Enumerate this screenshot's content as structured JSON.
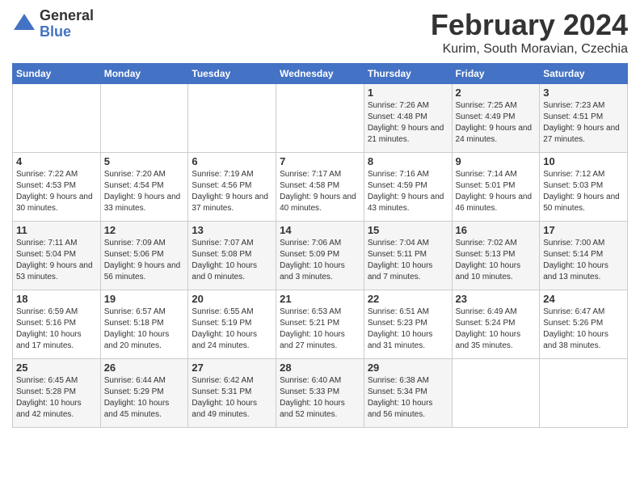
{
  "logo": {
    "general": "General",
    "blue": "Blue"
  },
  "title": {
    "month_year": "February 2024",
    "location": "Kurim, South Moravian, Czechia"
  },
  "days_of_week": [
    "Sunday",
    "Monday",
    "Tuesday",
    "Wednesday",
    "Thursday",
    "Friday",
    "Saturday"
  ],
  "weeks": [
    [
      {
        "day": "",
        "content": ""
      },
      {
        "day": "",
        "content": ""
      },
      {
        "day": "",
        "content": ""
      },
      {
        "day": "",
        "content": ""
      },
      {
        "day": "1",
        "content": "Sunrise: 7:26 AM\nSunset: 4:48 PM\nDaylight: 9 hours\nand 21 minutes."
      },
      {
        "day": "2",
        "content": "Sunrise: 7:25 AM\nSunset: 4:49 PM\nDaylight: 9 hours\nand 24 minutes."
      },
      {
        "day": "3",
        "content": "Sunrise: 7:23 AM\nSunset: 4:51 PM\nDaylight: 9 hours\nand 27 minutes."
      }
    ],
    [
      {
        "day": "4",
        "content": "Sunrise: 7:22 AM\nSunset: 4:53 PM\nDaylight: 9 hours\nand 30 minutes."
      },
      {
        "day": "5",
        "content": "Sunrise: 7:20 AM\nSunset: 4:54 PM\nDaylight: 9 hours\nand 33 minutes."
      },
      {
        "day": "6",
        "content": "Sunrise: 7:19 AM\nSunset: 4:56 PM\nDaylight: 9 hours\nand 37 minutes."
      },
      {
        "day": "7",
        "content": "Sunrise: 7:17 AM\nSunset: 4:58 PM\nDaylight: 9 hours\nand 40 minutes."
      },
      {
        "day": "8",
        "content": "Sunrise: 7:16 AM\nSunset: 4:59 PM\nDaylight: 9 hours\nand 43 minutes."
      },
      {
        "day": "9",
        "content": "Sunrise: 7:14 AM\nSunset: 5:01 PM\nDaylight: 9 hours\nand 46 minutes."
      },
      {
        "day": "10",
        "content": "Sunrise: 7:12 AM\nSunset: 5:03 PM\nDaylight: 9 hours\nand 50 minutes."
      }
    ],
    [
      {
        "day": "11",
        "content": "Sunrise: 7:11 AM\nSunset: 5:04 PM\nDaylight: 9 hours\nand 53 minutes."
      },
      {
        "day": "12",
        "content": "Sunrise: 7:09 AM\nSunset: 5:06 PM\nDaylight: 9 hours\nand 56 minutes."
      },
      {
        "day": "13",
        "content": "Sunrise: 7:07 AM\nSunset: 5:08 PM\nDaylight: 10 hours\nand 0 minutes."
      },
      {
        "day": "14",
        "content": "Sunrise: 7:06 AM\nSunset: 5:09 PM\nDaylight: 10 hours\nand 3 minutes."
      },
      {
        "day": "15",
        "content": "Sunrise: 7:04 AM\nSunset: 5:11 PM\nDaylight: 10 hours\nand 7 minutes."
      },
      {
        "day": "16",
        "content": "Sunrise: 7:02 AM\nSunset: 5:13 PM\nDaylight: 10 hours\nand 10 minutes."
      },
      {
        "day": "17",
        "content": "Sunrise: 7:00 AM\nSunset: 5:14 PM\nDaylight: 10 hours\nand 13 minutes."
      }
    ],
    [
      {
        "day": "18",
        "content": "Sunrise: 6:59 AM\nSunset: 5:16 PM\nDaylight: 10 hours\nand 17 minutes."
      },
      {
        "day": "19",
        "content": "Sunrise: 6:57 AM\nSunset: 5:18 PM\nDaylight: 10 hours\nand 20 minutes."
      },
      {
        "day": "20",
        "content": "Sunrise: 6:55 AM\nSunset: 5:19 PM\nDaylight: 10 hours\nand 24 minutes."
      },
      {
        "day": "21",
        "content": "Sunrise: 6:53 AM\nSunset: 5:21 PM\nDaylight: 10 hours\nand 27 minutes."
      },
      {
        "day": "22",
        "content": "Sunrise: 6:51 AM\nSunset: 5:23 PM\nDaylight: 10 hours\nand 31 minutes."
      },
      {
        "day": "23",
        "content": "Sunrise: 6:49 AM\nSunset: 5:24 PM\nDaylight: 10 hours\nand 35 minutes."
      },
      {
        "day": "24",
        "content": "Sunrise: 6:47 AM\nSunset: 5:26 PM\nDaylight: 10 hours\nand 38 minutes."
      }
    ],
    [
      {
        "day": "25",
        "content": "Sunrise: 6:45 AM\nSunset: 5:28 PM\nDaylight: 10 hours\nand 42 minutes."
      },
      {
        "day": "26",
        "content": "Sunrise: 6:44 AM\nSunset: 5:29 PM\nDaylight: 10 hours\nand 45 minutes."
      },
      {
        "day": "27",
        "content": "Sunrise: 6:42 AM\nSunset: 5:31 PM\nDaylight: 10 hours\nand 49 minutes."
      },
      {
        "day": "28",
        "content": "Sunrise: 6:40 AM\nSunset: 5:33 PM\nDaylight: 10 hours\nand 52 minutes."
      },
      {
        "day": "29",
        "content": "Sunrise: 6:38 AM\nSunset: 5:34 PM\nDaylight: 10 hours\nand 56 minutes."
      },
      {
        "day": "",
        "content": ""
      },
      {
        "day": "",
        "content": ""
      }
    ]
  ]
}
